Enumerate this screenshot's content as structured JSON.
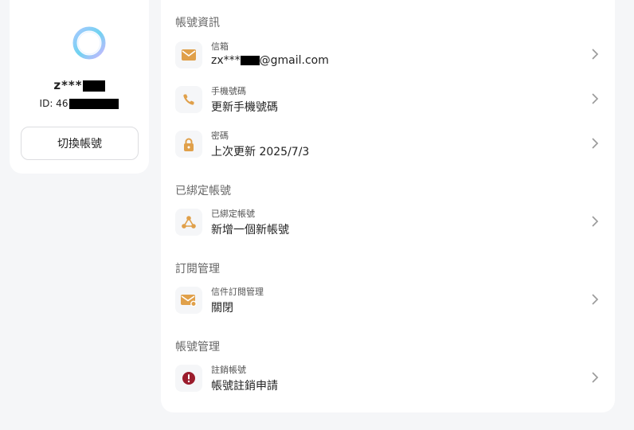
{
  "profile": {
    "username_visible": "z***",
    "id_prefix": "ID: 46",
    "switch_label": "切換帳號"
  },
  "sections": [
    {
      "title": "帳號資訊",
      "rows": [
        {
          "label": "信箱",
          "value_prefix": "zx***",
          "value_suffix": "@gmail.com",
          "icon": "mail-icon"
        },
        {
          "label": "手機號碼",
          "value": "更新手機號碼",
          "icon": "phone-icon"
        },
        {
          "label": "密碼",
          "value": "上次更新 2025/7/3",
          "icon": "lock-icon"
        }
      ]
    },
    {
      "title": "已綁定帳號",
      "rows": [
        {
          "label": "已綁定帳號",
          "value": "新增一個新帳號",
          "icon": "share-link-icon"
        }
      ]
    },
    {
      "title": "訂閱管理",
      "rows": [
        {
          "label": "信件訂閱管理",
          "value": "關閉",
          "icon": "mail-subscription-icon"
        }
      ]
    },
    {
      "title": "帳號管理",
      "rows": [
        {
          "label": "註銷帳號",
          "value": "帳號註銷申請",
          "icon": "alert-icon"
        }
      ]
    }
  ],
  "colors": {
    "accent": "#e0a04a",
    "danger": "#9b1c2c",
    "background": "#f5f6f8"
  }
}
